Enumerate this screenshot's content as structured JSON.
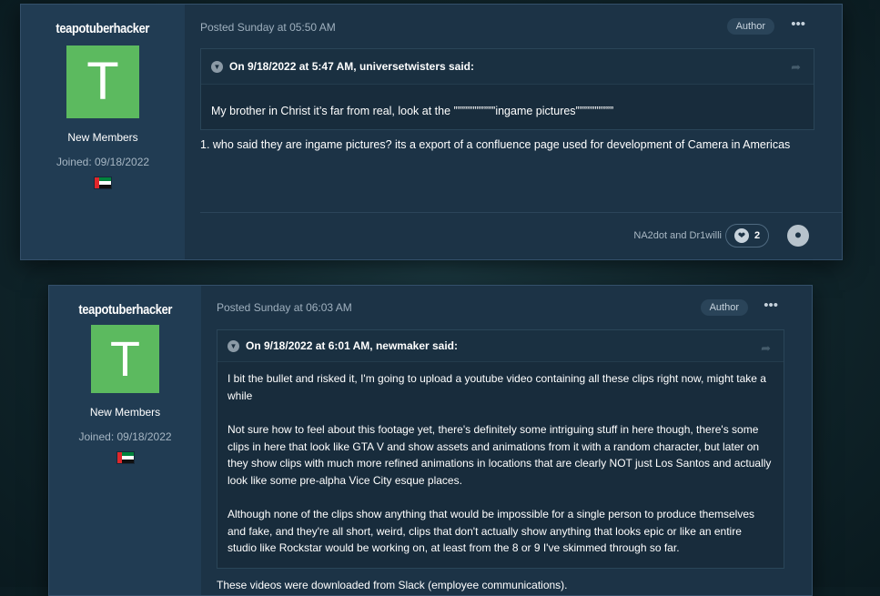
{
  "posts": [
    {
      "username": "teapotuberhacker",
      "avatar_letter": "T",
      "avatar_color": "#5cba5f",
      "group": "New Members",
      "joined": "Joined: 09/18/2022",
      "posted": "Posted Sunday at 05:50 AM",
      "badge": "Author",
      "more": "•••",
      "quote_header": "On 9/18/2022 at 5:47 AM, universetwisters said:",
      "quote_paragraphs": [
        "My brother in Christ it’s far from real, look at the ”””””””””””ingame pictures””””””””””"
      ],
      "reply": "1. who said they are ingame pictures? its a export of a confluence page used for development of Camera in Americas",
      "reactors": "NA2dot and Dr1willi",
      "reaction_count": "2"
    },
    {
      "username": "teapotuberhacker",
      "avatar_letter": "T",
      "avatar_color": "#5cba5f",
      "group": "New Members",
      "joined": "Joined: 09/18/2022",
      "posted": "Posted Sunday at 06:03 AM",
      "badge": "Author",
      "more": "•••",
      "quote_header": "On 9/18/2022 at 6:01 AM, newmaker said:",
      "quote_paragraphs": [
        "I bit the bullet and risked it, I'm going to upload a youtube video containing all these clips right now, might take a while",
        "Not sure how to feel about this footage yet, there's definitely some intriguing stuff in here though, there's some clips in here that look like GTA V and show assets and animations from it with a random character, but later on they show clips with much more refined animations in locations that are clearly NOT just Los Santos and actually look like some pre-alpha Vice City esque places.",
        "Although none of the clips show anything that would be impossible for a single person to produce themselves and fake, and they're all short, weird, clips that don't actually show anything that looks epic or like an entire studio like Rockstar would be working on, at least from the 8 or 9 I've skimmed through so far."
      ],
      "reply": "These videos were downloaded from Slack (employee communications)."
    }
  ],
  "icons": {
    "quote_toggle": "chevron-down-icon",
    "share": "share-icon",
    "like": "thumbs-up-icon",
    "flag": "uae-flag-icon"
  }
}
